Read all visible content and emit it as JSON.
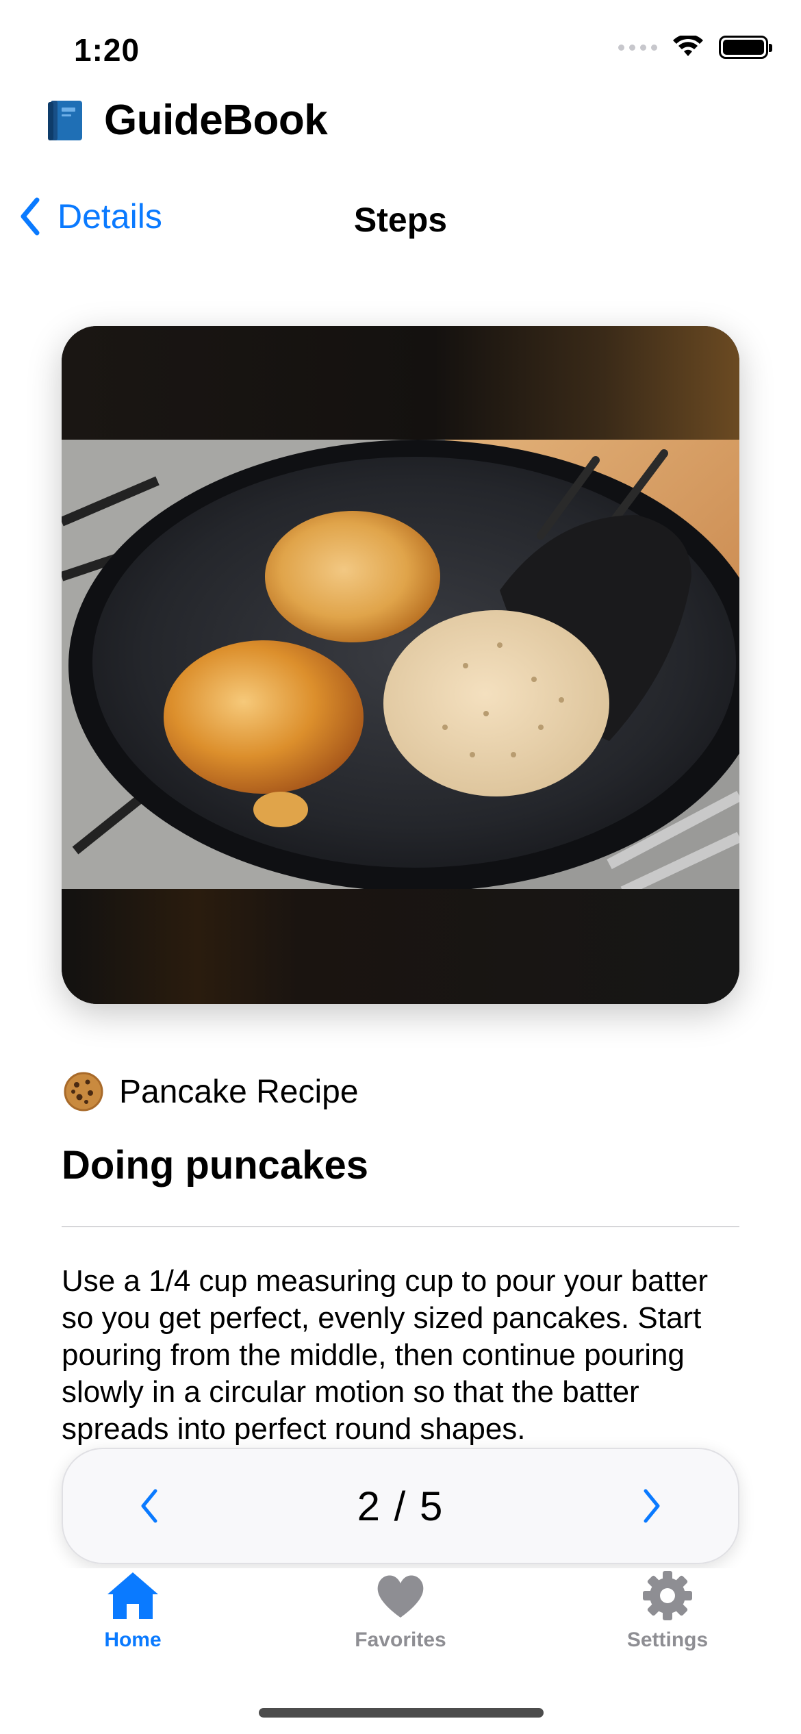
{
  "status": {
    "time": "1:20"
  },
  "app": {
    "title": "GuideBook",
    "icon": "book-icon"
  },
  "nav": {
    "back_label": "Details",
    "title": "Steps"
  },
  "recipe": {
    "icon": "cookie-icon",
    "label": "Pancake Recipe",
    "step_title": "Doing puncakes",
    "step_body": "Use a 1/4 cup measuring cup to pour your batter so you get perfect, evenly sized pancakes. Start pouring from the middle, then continue pouring slowly in a circular motion so that the batter spreads into perfect round shapes."
  },
  "pager": {
    "count": "2 / 5",
    "current": 2,
    "total": 5
  },
  "tabs": [
    {
      "label": "Home",
      "icon": "house-icon",
      "selected": true
    },
    {
      "label": "Favorites",
      "icon": "heart-icon",
      "selected": false
    },
    {
      "label": "Settings",
      "icon": "gear-icon",
      "selected": false
    }
  ],
  "colors": {
    "accent": "#0a7aff",
    "inactive": "#8e8e93"
  }
}
